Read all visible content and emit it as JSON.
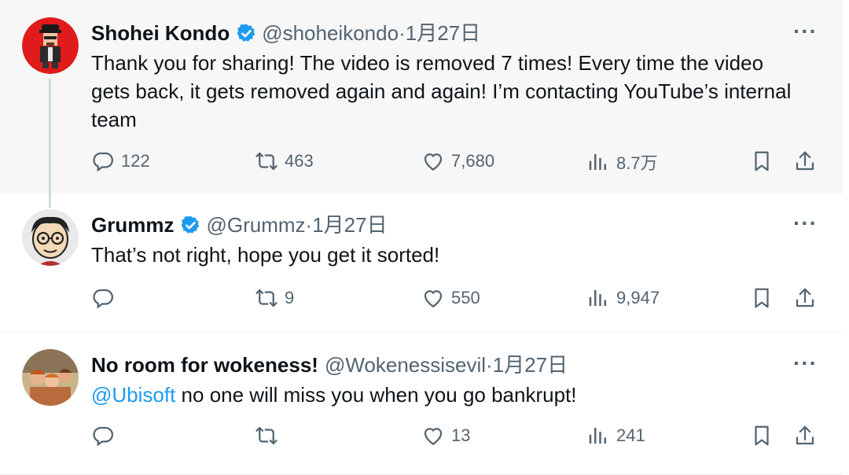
{
  "tweets": [
    {
      "name": "Shohei Kondo",
      "handle": "@shoheikondo",
      "date": "1月27日",
      "text": "Thank you for sharing! The video is removed 7 times! Every time the video gets back, it gets removed again and again! I’m contacting YouTube’s internal team",
      "replies": "122",
      "retweets": "463",
      "likes": "7,680",
      "views": "8.7万"
    },
    {
      "name": "Grummz",
      "handle": "@Grummz",
      "date": "1月27日",
      "text": "That’s not right, hope you get it sorted!",
      "replies": "",
      "retweets": "9",
      "likes": "550",
      "views": "9,947"
    },
    {
      "name": "No room for wokeness!",
      "handle": "@Wokenessisevil",
      "date": "1月27日",
      "mention": "@Ubisoft",
      "text": " no one will miss you when you go bankrupt!",
      "replies": "",
      "retweets": "",
      "likes": "13",
      "views": "241"
    }
  ],
  "ui": {
    "more": "···",
    "separator": " · "
  },
  "colors": {
    "accent": "#1d9bf0",
    "muted": "#536471",
    "verified": "#1d9bf0"
  }
}
